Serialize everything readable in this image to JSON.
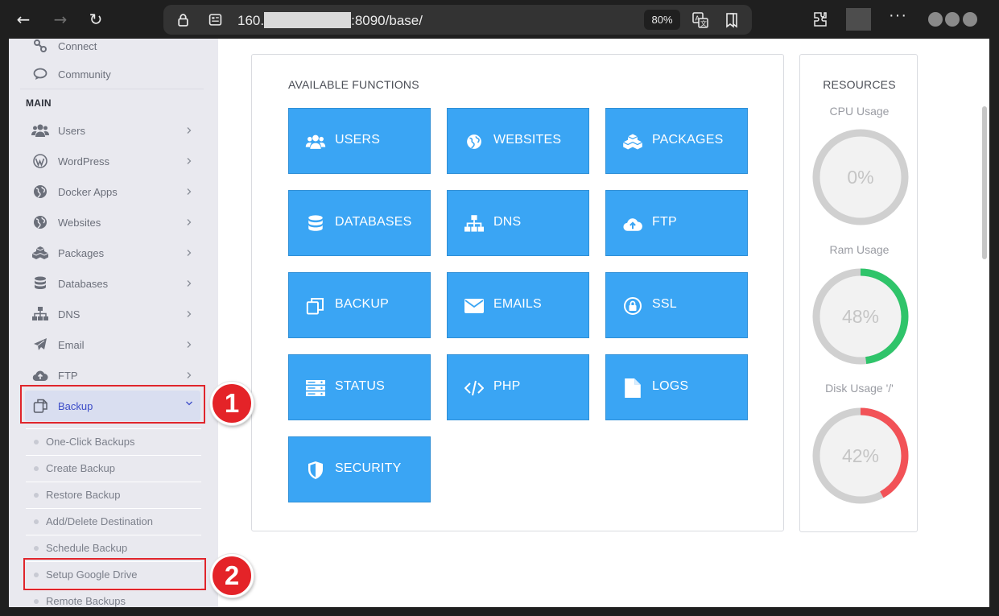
{
  "browser": {
    "url_prefix": "160.",
    "url_suffix": ":8090/base/",
    "zoom": "80%"
  },
  "sidebar": {
    "top_items": [
      {
        "label": "Connect",
        "icon": "connect-icon"
      },
      {
        "label": "Community",
        "icon": "chat-icon"
      }
    ],
    "section_heading": "MAIN",
    "items": [
      {
        "label": "Users",
        "icon": "users-icon"
      },
      {
        "label": "WordPress",
        "icon": "wordpress-icon"
      },
      {
        "label": "Docker Apps",
        "icon": "globe-icon"
      },
      {
        "label": "Websites",
        "icon": "globe-icon"
      },
      {
        "label": "Packages",
        "icon": "cubes-icon"
      },
      {
        "label": "Databases",
        "icon": "database-icon"
      },
      {
        "label": "DNS",
        "icon": "sitemap-icon"
      },
      {
        "label": "Email",
        "icon": "paper-plane-icon"
      },
      {
        "label": "FTP",
        "icon": "cloud-upload-icon"
      }
    ],
    "active_item": {
      "label": "Backup",
      "icon": "copy-icon"
    },
    "sub_items": [
      {
        "label": "One-Click Backups"
      },
      {
        "label": "Create Backup"
      },
      {
        "label": "Restore Backup"
      },
      {
        "label": "Add/Delete Destination"
      },
      {
        "label": "Schedule Backup"
      },
      {
        "label": "Setup Google Drive"
      },
      {
        "label": "Remote Backups"
      }
    ]
  },
  "annotations": [
    {
      "number": "1",
      "target": "Backup"
    },
    {
      "number": "2",
      "target": "Setup Google Drive"
    }
  ],
  "functions": {
    "title": "AVAILABLE FUNCTIONS",
    "tiles": [
      {
        "label": "USERS",
        "icon": "users-icon"
      },
      {
        "label": "WEBSITES",
        "icon": "globe-icon"
      },
      {
        "label": "PACKAGES",
        "icon": "cubes-icon"
      },
      {
        "label": "DATABASES",
        "icon": "database-icon"
      },
      {
        "label": "DNS",
        "icon": "sitemap-icon"
      },
      {
        "label": "FTP",
        "icon": "cloud-upload-icon"
      },
      {
        "label": "BACKUP",
        "icon": "copy-icon"
      },
      {
        "label": "EMAILS",
        "icon": "envelope-icon"
      },
      {
        "label": "SSL",
        "icon": "lock-icon"
      },
      {
        "label": "STATUS",
        "icon": "server-icon"
      },
      {
        "label": "PHP",
        "icon": "code-icon"
      },
      {
        "label": "LOGS",
        "icon": "file-icon"
      },
      {
        "label": "SECURITY",
        "icon": "shield-icon"
      }
    ],
    "tile_color": "#3aa5f4"
  },
  "resources": {
    "title": "RESOURCES",
    "gauges": [
      {
        "label": "CPU Usage",
        "value_text": "0%",
        "value": 0,
        "color": "#d0d0d0"
      },
      {
        "label": "Ram Usage",
        "value_text": "48%",
        "value": 48,
        "color": "#2fc46a"
      },
      {
        "label": "Disk Usage '/'",
        "value_text": "42%",
        "value": 42,
        "color": "#f25257"
      }
    ]
  }
}
